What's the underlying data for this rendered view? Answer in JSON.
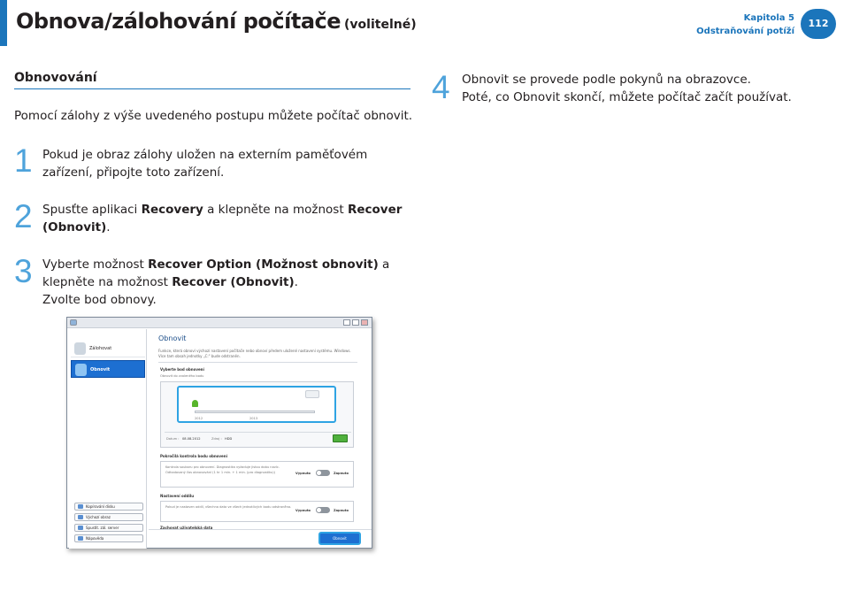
{
  "header": {
    "title": "Obnova/zálohování počítače",
    "subtitle": "(volitelné)",
    "chapter": "Kapitola 5",
    "chapter_name": "Odstraňování potíží",
    "page_number": "112"
  },
  "section": {
    "title": "Obnovování",
    "intro": "Pomocí zálohy z výše uvedeného postupu můžete počítač obnovit."
  },
  "steps": [
    {
      "num": "1",
      "line1": "Pokud je obraz zálohy uložen na externím paměťovém",
      "line2": "zařízení, připojte toto zařízení."
    },
    {
      "num": "2",
      "pre": "Spusťte aplikaci ",
      "b1": "Recovery",
      "mid": " a klepněte na možnost ",
      "b2": "Recover",
      "b3": "(Obnovit)",
      "post": "."
    },
    {
      "num": "3",
      "pre": "Vyberte možnost ",
      "b1": "Recover Option (Možnost obnovit)",
      "mid": " a",
      "line2pre": "klepněte na možnost ",
      "b2": "Recover (Obnovit)",
      "post": ".",
      "line3": "Zvolte bod obnovy."
    },
    {
      "num": "4",
      "line1": "Obnovit se provede podle pokynů na obrazovce.",
      "line2": "Poté, co Obnovit skončí, můžete počítač začít používat."
    }
  ],
  "screenshot": {
    "side_buttons": [
      "Zálohovat",
      "Obnovit"
    ],
    "side_links": [
      "Kopírování disku",
      "Výchozí obraz",
      "Spustit. zál. server",
      "Nápověda"
    ],
    "title": "Obnovit",
    "desc": "Funkce, která obnoví výchozí nastavení počítače nebo obnoví předem uložené nastavení systému. Windows. Více tam obsah jednotky „C:\" bude odstraněn.",
    "section1": "Vyberte bod obnovení",
    "section1_sub": "Obnovit do zvoleného bodu",
    "years": [
      "2012",
      "2013"
    ],
    "date_label": "Datum :",
    "date_value": "08.08.2012",
    "source_label": "Zdroj :",
    "source_value": "HDD",
    "section2": "Pokročilá kontrola bodu obnovení",
    "section2_desc": "Kontrola souboru pro obnovení. Diagnostika vyžaduje jistou dobu navíc. Odhadovaný čas obnovování (1 hr 1 min. + 1 min. (pro diagnostiku))",
    "toggle_off": "Vypnuto",
    "toggle_on": "Zapnuto",
    "section3": "Nastavení oddílu",
    "section3_desc": "Pokud je nastaven oddíl, všechna data ve všech jednotlivých bodu odstraněna.",
    "section4": "Zachovat uživatelská data",
    "recover_button": "Obnovit"
  },
  "colors": {
    "accent": "#1b75bb",
    "step_number": "#4ea3db"
  }
}
